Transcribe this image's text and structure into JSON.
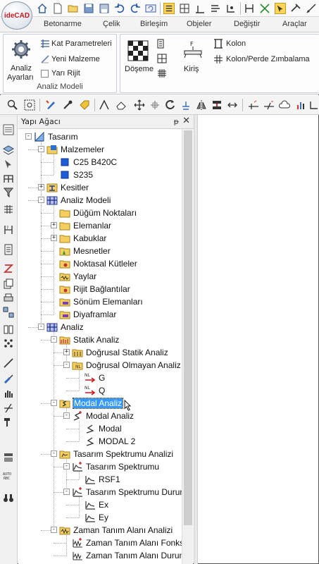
{
  "app": {
    "logo_text": "ideCAD"
  },
  "tabs": [
    "Betonarme",
    "Çelik",
    "Birleşim",
    "Objeler",
    "Değiştir",
    "Araçlar"
  ],
  "ribbon": {
    "analysis_group": {
      "settings_label_1": "Analiz",
      "settings_label_2": "Ayarları",
      "items": [
        "Kat Parametreleri",
        "Yeni Malzeme",
        "Yarı Rijit"
      ],
      "label": "Analiz Modeli"
    },
    "slab_label": "Döşeme",
    "beam_label": "Kiriş",
    "column_label": "Kolon",
    "punching_label": "Kolon/Perde Zımbalama"
  },
  "panel": {
    "title": "Yapı Ağacı",
    "pin": "ᵽ",
    "close": "✕"
  },
  "tree": [
    {
      "id": "tasarim",
      "label": "Tasarım",
      "level": 0,
      "exp": "-",
      "icon": "design"
    },
    {
      "id": "malzemeler",
      "label": "Malzemeler",
      "level": 1,
      "exp": "-",
      "icon": "folder-blue"
    },
    {
      "id": "c25",
      "label": "C25 B420C",
      "level": 2,
      "exp": "",
      "icon": "square-blue"
    },
    {
      "id": "s235",
      "label": "S235",
      "level": 2,
      "exp": "",
      "icon": "square-blue"
    },
    {
      "id": "kesitler",
      "label": "Kesitler",
      "level": 1,
      "exp": "+",
      "icon": "section"
    },
    {
      "id": "analiz-modeli",
      "label": "Analiz Modeli",
      "level": 1,
      "exp": "-",
      "icon": "frame"
    },
    {
      "id": "dugum",
      "label": "Düğüm Noktaları",
      "level": 2,
      "exp": "",
      "icon": "folder"
    },
    {
      "id": "elemanlar",
      "label": "Elemanlar",
      "level": 2,
      "exp": "+",
      "icon": "folder"
    },
    {
      "id": "kabuklar",
      "label": "Kabuklar",
      "level": 2,
      "exp": "+",
      "icon": "folder"
    },
    {
      "id": "mesnetler",
      "label": "Mesnetler",
      "level": 2,
      "exp": "",
      "icon": "folder-green"
    },
    {
      "id": "noktasal",
      "label": "Noktasal Kütleler",
      "level": 2,
      "exp": "",
      "icon": "folder-red"
    },
    {
      "id": "yaylar",
      "label": "Yaylar",
      "level": 2,
      "exp": "",
      "icon": "folder-spring"
    },
    {
      "id": "rijit",
      "label": "Rijit Bağlantılar",
      "level": 2,
      "exp": "",
      "icon": "folder-red"
    },
    {
      "id": "sonum",
      "label": "Sönüm Elemanları",
      "level": 2,
      "exp": "",
      "icon": "folder-purple"
    },
    {
      "id": "diyafram",
      "label": "Diyaframlar",
      "level": 2,
      "exp": "",
      "icon": "folder-purple"
    },
    {
      "id": "analiz",
      "label": "Analiz",
      "level": 1,
      "exp": "-",
      "icon": "frame"
    },
    {
      "id": "statik",
      "label": "Statik Analiz",
      "level": 2,
      "exp": "-",
      "icon": "folder-pink"
    },
    {
      "id": "dogrusal-statik",
      "label": "Doğrusal Statik Analiz",
      "level": 3,
      "exp": "+",
      "icon": "folder-stat"
    },
    {
      "id": "dogrusal-olmayan",
      "label": "Doğrusal Olmayan Analiz",
      "level": 3,
      "exp": "-",
      "icon": "folder-nl"
    },
    {
      "id": "g",
      "label": "G",
      "level": 4,
      "exp": "",
      "icon": "nl-arrow"
    },
    {
      "id": "q",
      "label": "Q",
      "level": 4,
      "exp": "",
      "icon": "nl-arrow"
    },
    {
      "id": "modal-analiz",
      "label": "Modal Analiz",
      "level": 2,
      "exp": "-",
      "icon": "folder-modal",
      "selected": true
    },
    {
      "id": "modal-analiz-2",
      "label": "Modal Analiz",
      "level": 3,
      "exp": "-",
      "icon": "modal-plus"
    },
    {
      "id": "modal",
      "label": "Modal",
      "level": 4,
      "exp": "",
      "icon": "modal"
    },
    {
      "id": "modal2",
      "label": "MODAL 2",
      "level": 4,
      "exp": "",
      "icon": "modal"
    },
    {
      "id": "spektrum-analizi",
      "label": "Tasarım Spektrumu Analizi",
      "level": 2,
      "exp": "-",
      "icon": "folder-spec"
    },
    {
      "id": "spektrum",
      "label": "Tasarım Spektrumu",
      "level": 3,
      "exp": "-",
      "icon": "spec-plus"
    },
    {
      "id": "rsf1",
      "label": "RSF1",
      "level": 4,
      "exp": "",
      "icon": "spec"
    },
    {
      "id": "spektrum-durumu",
      "label": "Tasarım Spektrumu Durumu",
      "level": 3,
      "exp": "-",
      "icon": "spec-plus"
    },
    {
      "id": "ex",
      "label": "Ex",
      "level": 4,
      "exp": "",
      "icon": "spec"
    },
    {
      "id": "ey",
      "label": "Ey",
      "level": 4,
      "exp": "",
      "icon": "spec"
    },
    {
      "id": "zaman-analizi",
      "label": "Zaman Tanım Alanı Analizi",
      "level": 2,
      "exp": "-",
      "icon": "folder-time"
    },
    {
      "id": "zaman-fonk",
      "label": "Zaman Tanım Alanı Fonksiyonu",
      "level": 3,
      "exp": "",
      "icon": "time-plus"
    },
    {
      "id": "zaman-durum",
      "label": "Zaman Tanım Alanı Durumu",
      "level": 3,
      "exp": "",
      "icon": "time"
    }
  ]
}
